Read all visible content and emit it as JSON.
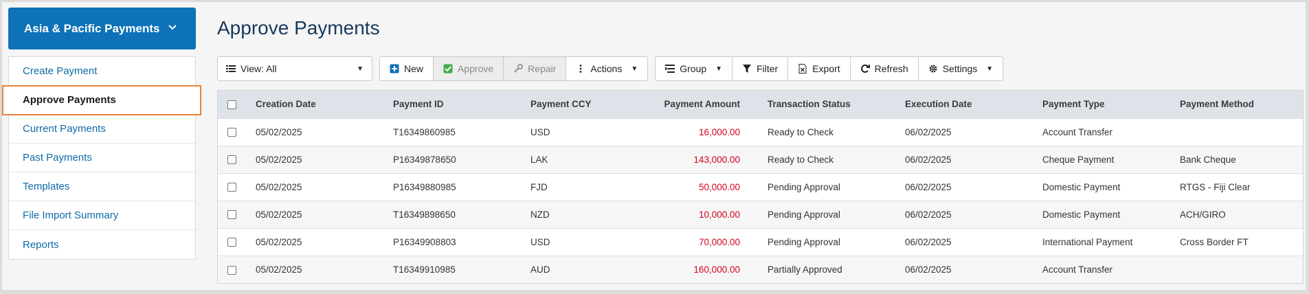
{
  "sidebar": {
    "header": "Asia & Pacific Payments",
    "items": [
      {
        "label": "Create Payment"
      },
      {
        "label": "Approve Payments"
      },
      {
        "label": "Current Payments"
      },
      {
        "label": "Past Payments"
      },
      {
        "label": "Templates"
      },
      {
        "label": "File Import Summary"
      },
      {
        "label": "Reports"
      }
    ],
    "active_index": 1
  },
  "page": {
    "title": "Approve Payments"
  },
  "toolbar": {
    "view_label": "View: All",
    "new_label": "New",
    "approve_label": "Approve",
    "repair_label": "Repair",
    "actions_label": "Actions",
    "group_label": "Group",
    "filter_label": "Filter",
    "export_label": "Export",
    "refresh_label": "Refresh",
    "settings_label": "Settings"
  },
  "table": {
    "columns": [
      "Creation Date",
      "Payment ID",
      "Payment CCY",
      "Payment Amount",
      "Transaction Status",
      "Execution Date",
      "Payment Type",
      "Payment Method"
    ],
    "rows": [
      [
        "05/02/2025",
        "T16349860985",
        "USD",
        "16,000.00",
        "Ready to Check",
        "06/02/2025",
        "Account Transfer",
        ""
      ],
      [
        "05/02/2025",
        "P16349878650",
        "LAK",
        "143,000.00",
        "Ready to Check",
        "06/02/2025",
        "Cheque Payment",
        "Bank Cheque"
      ],
      [
        "05/02/2025",
        "P16349880985",
        "FJD",
        "50,000.00",
        "Pending Approval",
        "06/02/2025",
        "Domestic Payment",
        "RTGS - Fiji Clear"
      ],
      [
        "05/02/2025",
        "T16349898650",
        "NZD",
        "10,000.00",
        "Pending Approval",
        "06/02/2025",
        "Domestic Payment",
        "ACH/GIRO"
      ],
      [
        "05/02/2025",
        "P16349908803",
        "USD",
        "70,000.00",
        "Pending Approval",
        "06/02/2025",
        "International Payment",
        "Cross Border FT"
      ],
      [
        "05/02/2025",
        "T16349910985",
        "AUD",
        "160,000.00",
        "Partially Approved",
        "06/02/2025",
        "Account Transfer",
        ""
      ]
    ]
  },
  "colors": {
    "brand": "#0d72b7",
    "amount": "#d0021b",
    "active_outline": "#e8833a",
    "approve_check": "#3fae49",
    "new_plus": "#0d72b7"
  },
  "icons": {
    "header": "chevron-down-icon",
    "view": "list-icon",
    "new": "plus-square-icon",
    "approve": "check-square-icon",
    "repair": "wrench-icon",
    "actions": "vertical-dots-icon",
    "group": "group-icon",
    "filter": "filter-icon",
    "export": "excel-file-icon",
    "refresh": "refresh-icon",
    "settings": "gear-icon"
  }
}
